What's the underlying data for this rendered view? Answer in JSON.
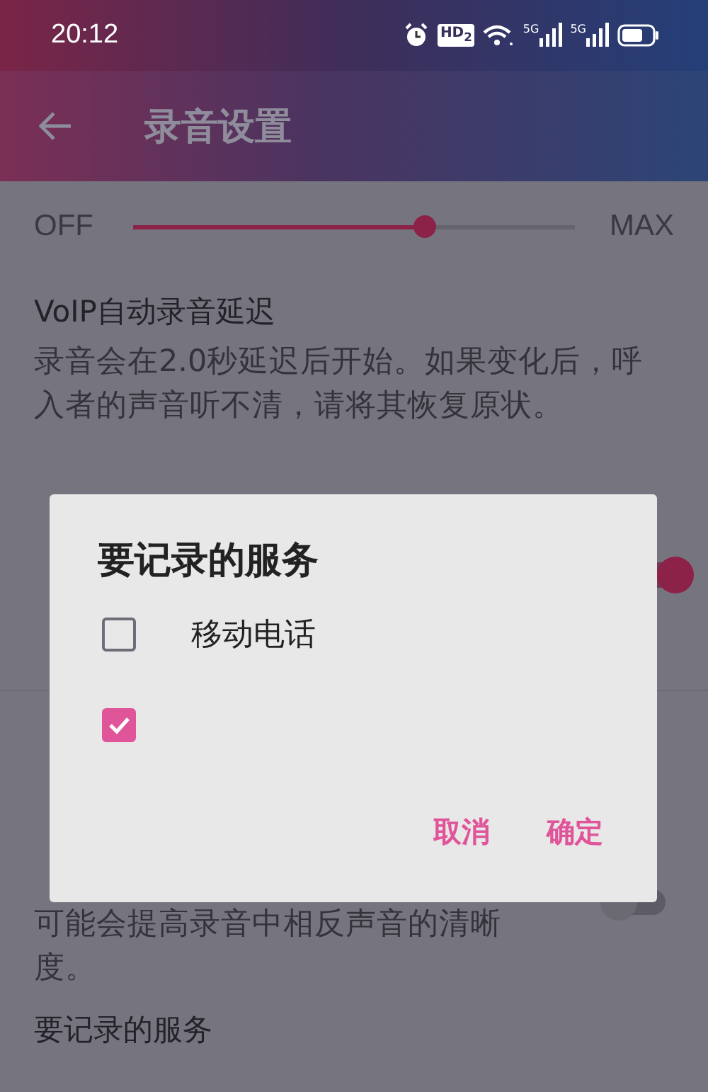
{
  "status_bar": {
    "time": "20:12",
    "hd_label": "HD$_{2}$",
    "network_labels": [
      "5G",
      "5G"
    ]
  },
  "app_bar": {
    "title": "录音设置"
  },
  "slider": {
    "min_label": "OFF",
    "max_label": "MAX",
    "level": 0.66
  },
  "settings": [
    {
      "kind": "text",
      "title": "VoIP自动录音延迟",
      "description": "录音会在2.0秒延迟后开始。如果变化后，呼入者的声音听不清，请将其恢复原状。"
    },
    {
      "kind": "toggle",
      "on": true
    },
    {
      "kind": "divider"
    },
    {
      "kind": "toggle",
      "lines": [
        "可能会提高录音中相反声音的清晰",
        "度。"
      ],
      "on": false
    },
    {
      "kind": "text",
      "title": "要记录的服务"
    }
  ],
  "dialog": {
    "title": "要记录的服务",
    "options": [
      {
        "label": "移动电话",
        "checked": false
      },
      {
        "checked": true
      }
    ],
    "buttons": [
      "取消",
      "确定"
    ]
  }
}
